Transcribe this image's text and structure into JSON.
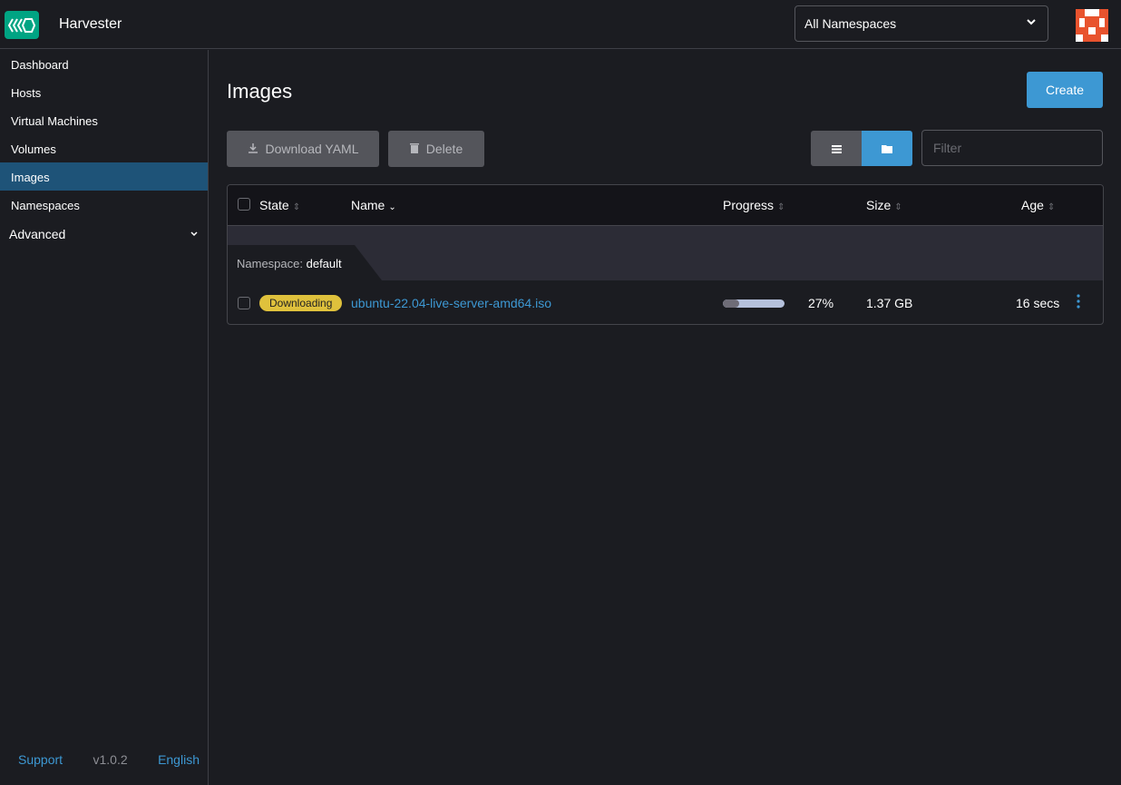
{
  "header": {
    "app_title": "Harvester",
    "namespace_select": "All Namespaces"
  },
  "sidebar": {
    "items": [
      {
        "label": "Dashboard"
      },
      {
        "label": "Hosts"
      },
      {
        "label": "Virtual Machines"
      },
      {
        "label": "Volumes"
      },
      {
        "label": "Images",
        "active": true
      },
      {
        "label": "Namespaces"
      }
    ],
    "group": "Advanced",
    "footer": {
      "support": "Support",
      "version": "v1.0.2",
      "language": "English"
    }
  },
  "main": {
    "title": "Images",
    "create": "Create",
    "download_yaml": "Download YAML",
    "delete": "Delete",
    "filter_placeholder": "Filter",
    "columns": {
      "state": "State",
      "name": "Name",
      "progress": "Progress",
      "size": "Size",
      "age": "Age"
    },
    "group_label": "Namespace:",
    "group_value": "default",
    "rows": [
      {
        "state": "Downloading",
        "name": "ubuntu-22.04-live-server-amd64.iso",
        "progress_percent": 27,
        "progress": "27%",
        "size": "1.37 GB",
        "age": "16 secs"
      }
    ]
  },
  "colors": {
    "accent": "#3d98d3",
    "brand": "#00a483",
    "badge": "#dfc13c"
  }
}
